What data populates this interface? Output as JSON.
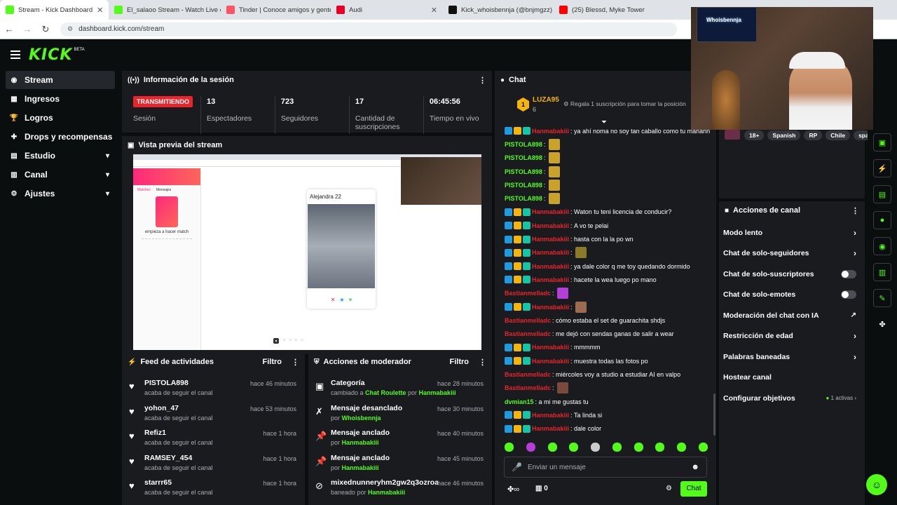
{
  "browser": {
    "tabs": [
      {
        "title": "Stream - Kick Dashboard",
        "color": "#53fc18"
      },
      {
        "title": "El_salaoo Stream - Watch Live o",
        "color": "#53fc18"
      },
      {
        "title": "Tinder | Conoce amigos y gente",
        "color": "#fd5564"
      },
      {
        "title": "Audi",
        "color": "#e60023"
      },
      {
        "title": "Kick_whoisbennja (@bnjmgzz)",
        "color": "#111111"
      },
      {
        "title": "(25) Blessd, Myke Towers -",
        "color": "#ff0000"
      }
    ],
    "url": "dashboard.kick.com/stream"
  },
  "app": {
    "logo": "KICK",
    "beta": "BETA"
  },
  "sidebar": {
    "items": [
      {
        "label": "Stream",
        "icon": "◉"
      },
      {
        "label": "Ingresos",
        "icon": "▦"
      },
      {
        "label": "Logros",
        "icon": "🏆"
      },
      {
        "label": "Drops y recompensas",
        "icon": "✚"
      },
      {
        "label": "Estudio",
        "icon": "▤"
      },
      {
        "label": "Canal",
        "icon": "▥"
      },
      {
        "label": "Ajustes",
        "icon": "⚙"
      }
    ]
  },
  "session": {
    "title": "Información de la sesión",
    "live": "TRANSMITIENDO",
    "live_label": "Sesión",
    "stats": [
      {
        "value": "13",
        "label": "Espectadores"
      },
      {
        "value": "723",
        "label": "Seguidores"
      },
      {
        "value": "17",
        "label": "Cantidad de suscripciones"
      },
      {
        "value": "06:45:56",
        "label": "Tiempo en vivo"
      }
    ]
  },
  "preview": {
    "title": "Vista previa del stream",
    "profile_name": "Alejandra 22",
    "match_title": "empieza a hacer match",
    "tabs": [
      "Matches",
      "Mensajes"
    ]
  },
  "feed": {
    "title": "Feed de actividades",
    "filter": "Filtro",
    "items": [
      {
        "name": "PISTOLA898",
        "sub": "acaba de seguir el canal",
        "time": "hace 46 minutos"
      },
      {
        "name": "yohon_47",
        "sub": "acaba de seguir el canal",
        "time": "hace 53 minutos"
      },
      {
        "name": "Refiz1",
        "sub": "acaba de seguir el canal",
        "time": "hace 1 hora"
      },
      {
        "name": "RAMSEY_454",
        "sub": "acaba de seguir el canal",
        "time": "hace 1 hora"
      },
      {
        "name": "starrr65",
        "sub": "acaba de seguir el canal",
        "time": "hace 1 hora"
      }
    ]
  },
  "mod": {
    "title": "Acciones de moderador",
    "filter": "Filtro",
    "items": [
      {
        "title": "Categoría",
        "pre": "cambiado a ",
        "hl": "Chat Roulette",
        "mid": " por ",
        "user": "Hanmabakiii",
        "time": "hace 28 minutos",
        "icon": "▣"
      },
      {
        "title": "Mensaje desanclado",
        "pre": "por ",
        "hl": "",
        "mid": "",
        "user": "Whoisbennja",
        "time": "hace 30 minutos",
        "icon": "✗"
      },
      {
        "title": "Mensaje anclado",
        "pre": "por ",
        "hl": "",
        "mid": "",
        "user": "Hanmabakiii",
        "time": "hace 40 minutos",
        "icon": "📌"
      },
      {
        "title": "Mensaje anclado",
        "pre": "por ",
        "hl": "",
        "mid": "",
        "user": "Hanmabakiii",
        "time": "hace 45 minutos",
        "icon": "📌"
      },
      {
        "title": "mixednunneryhm2gw2q3ozroa",
        "pre": "baneado por ",
        "hl": "",
        "mid": "",
        "user": "Hanmabakiii",
        "time": "hace 46 minutos",
        "icon": "⊘"
      }
    ]
  },
  "chat": {
    "title": "Chat",
    "top_user": "LUZA95",
    "top_count": "6",
    "gift_text": "Regala 1 suscripción para tomar la posición",
    "input_placeholder": "Enviar un mensaje",
    "send": "Chat",
    "bottom_count": "0",
    "messages": [
      {
        "user": "Hanmabakiii",
        "color": "#e9242b",
        "badges": true,
        "text": "ya ahí noma no soy tan caballo como tu mariann",
        "emote": ""
      },
      {
        "user": "PISTOLA898",
        "color": "#53fc18",
        "badges": false,
        "text": "",
        "emote": "#c9a227"
      },
      {
        "user": "PISTOLA898",
        "color": "#53fc18",
        "badges": false,
        "text": "",
        "emote": "#c9a227"
      },
      {
        "user": "PISTOLA898",
        "color": "#53fc18",
        "badges": false,
        "text": "",
        "emote": "#c9a227"
      },
      {
        "user": "PISTOLA898",
        "color": "#53fc18",
        "badges": false,
        "text": "",
        "emote": "#c9a227"
      },
      {
        "user": "PISTOLA898",
        "color": "#53fc18",
        "badges": false,
        "text": "",
        "emote": "#c9a227"
      },
      {
        "user": "Hanmabakiii",
        "color": "#e9242b",
        "badges": true,
        "text": "Waton tu teni licencia de conducir?",
        "emote": ""
      },
      {
        "user": "Hanmabakiii",
        "color": "#e9242b",
        "badges": true,
        "text": "A vo te pelai",
        "emote": ""
      },
      {
        "user": "Hanmabakiii",
        "color": "#e9242b",
        "badges": true,
        "text": "hasta con la la po wn",
        "emote": ""
      },
      {
        "user": "Hanmabakiii",
        "color": "#e9242b",
        "badges": true,
        "text": "",
        "emote": "#8a7a2a"
      },
      {
        "user": "Hanmabakiii",
        "color": "#e9242b",
        "badges": true,
        "text": "ya dale color q me toy quedando dormido",
        "emote": ""
      },
      {
        "user": "Hanmabakiii",
        "color": "#e9242b",
        "badges": true,
        "text": "hacete la wea luego po mano",
        "emote": ""
      },
      {
        "user": "Bastianmelladc",
        "color": "#e9242b",
        "badges": false,
        "text": "",
        "emote": "#b43fd6"
      },
      {
        "user": "Hanmabakiii",
        "color": "#e9242b",
        "badges": true,
        "text": "",
        "emote": "#9a6b4f"
      },
      {
        "user": "Bastianmelladc",
        "color": "#e9242b",
        "badges": false,
        "text": "cómo estaba el set de guarachita shdjs",
        "emote": ""
      },
      {
        "user": "Bastianmelladc",
        "color": "#e9242b",
        "badges": false,
        "text": "me dejó con sendas ganas de salir a wear",
        "emote": ""
      },
      {
        "user": "Hanmabakiii",
        "color": "#e9242b",
        "badges": true,
        "text": "mmmmm",
        "emote": ""
      },
      {
        "user": "Hanmabakiii",
        "color": "#e9242b",
        "badges": true,
        "text": "muestra todas las fotos po",
        "emote": ""
      },
      {
        "user": "Bastianmelladc",
        "color": "#e9242b",
        "badges": false,
        "text": "miércoles voy a studio a estudiar AI en valpo",
        "emote": ""
      },
      {
        "user": "Bastianmelladc",
        "color": "#e9242b",
        "badges": false,
        "text": "",
        "emote": "#7a4a3a"
      },
      {
        "user": "dvmian15",
        "color": "#53fc18",
        "badges": false,
        "text": "a mi me gustas tu",
        "emote": ""
      },
      {
        "user": "Hanmabakiii",
        "color": "#e9242b",
        "badges": true,
        "text": "Ta linda si",
        "emote": ""
      },
      {
        "user": "Hanmabakiii",
        "color": "#e9242b",
        "badges": true,
        "text": "dale color",
        "emote": ""
      }
    ]
  },
  "tags": [
    "18+",
    "Spanish",
    "RP",
    "Chile",
    "spar"
  ],
  "channel_actions": {
    "title": "Acciones de canal",
    "items": [
      {
        "label": "Modo lento",
        "kind": "chevron"
      },
      {
        "label": "Chat de solo-seguidores",
        "kind": "chevron"
      },
      {
        "label": "Chat de solo-suscriptores",
        "kind": "toggle"
      },
      {
        "label": "Chat de solo-emotes",
        "kind": "toggle"
      },
      {
        "label": "Moderación del chat con IA",
        "kind": "external"
      },
      {
        "label": "Restricción de edad",
        "kind": "chevron"
      },
      {
        "label": "Palabras baneadas",
        "kind": "chevron"
      },
      {
        "label": "Hostear canal",
        "kind": "none"
      },
      {
        "label": "Configurar objetivos",
        "kind": "goals"
      }
    ],
    "goals_status": "1 activas"
  },
  "webcam": {
    "sign": "Whoisbennja"
  }
}
